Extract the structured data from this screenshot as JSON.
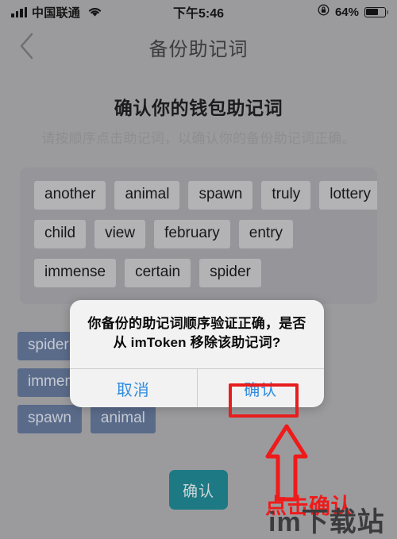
{
  "status_bar": {
    "carrier": "中国联通",
    "time": "下午5:46",
    "battery_percent": "64%",
    "signal_icon": "signal-bars-icon",
    "wifi_icon": "wifi-icon",
    "rotation_lock_icon": "rotation-lock-icon",
    "battery_icon": "battery-icon"
  },
  "nav": {
    "back_icon": "back-chevron-icon",
    "title": "备份助记词"
  },
  "page": {
    "heading": "确认你的钱包助记词",
    "subheading": "请按顺序点击助记词，以确认你的备份助记词正确。"
  },
  "word_pool": {
    "rows": [
      [
        "another",
        "animal",
        "spawn",
        "truly",
        "lottery"
      ],
      [
        "child",
        "view",
        "february",
        "entry"
      ],
      [
        "immense",
        "certain",
        "spider"
      ]
    ]
  },
  "selected_words": {
    "rows": [
      [
        "spider"
      ],
      [
        "immense"
      ],
      [
        "spawn",
        "animal"
      ]
    ]
  },
  "primary_button": {
    "label": "确认"
  },
  "dialog": {
    "message": "你备份的助记词顺序验证正确，是否从 imToken 移除该助记词?",
    "cancel_label": "取消",
    "confirm_label": "确认"
  },
  "annotation": {
    "arrow_icon": "up-arrow-icon",
    "label": "点击确认",
    "color": "#ee1b1b"
  },
  "watermark": {
    "text": "im下载站"
  },
  "colors": {
    "background": "#9b9b9d",
    "pool_panel": "#96969a",
    "pool_chip": "#b3b3b6",
    "selected_chip": "#5a6b8a",
    "teal_button": "#1d7a85",
    "dialog_blue": "#2f8ce0",
    "highlight_red": "#e81d1d"
  }
}
